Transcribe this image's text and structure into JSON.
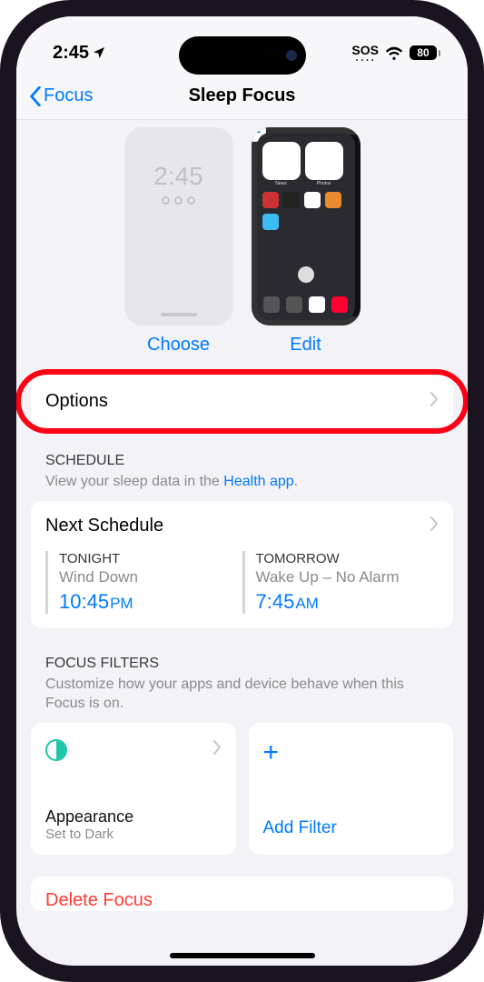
{
  "status": {
    "time": "2:45",
    "sos": "SOS",
    "battery": "80"
  },
  "nav": {
    "back": "Focus",
    "title": "Sleep Focus"
  },
  "previews": {
    "lock_time": "2:45",
    "choose": "Choose",
    "edit": "Edit"
  },
  "options": {
    "label": "Options"
  },
  "schedule": {
    "header": "SCHEDULE",
    "sub_prefix": "View your sleep data in the ",
    "sub_link": "Health app",
    "title": "Next Schedule",
    "tonight": {
      "label": "TONIGHT",
      "detail": "Wind Down",
      "time": "10:45",
      "ampm": "PM"
    },
    "tomorrow": {
      "label": "TOMORROW",
      "detail": "Wake Up – No Alarm",
      "time": "7:45",
      "ampm": "AM"
    }
  },
  "filters": {
    "header": "FOCUS FILTERS",
    "sub": "Customize how your apps and device behave when this Focus is on.",
    "appearance": {
      "title": "Appearance",
      "sub": "Set to Dark"
    },
    "add": "Add Filter"
  },
  "delete": "Delete Focus"
}
